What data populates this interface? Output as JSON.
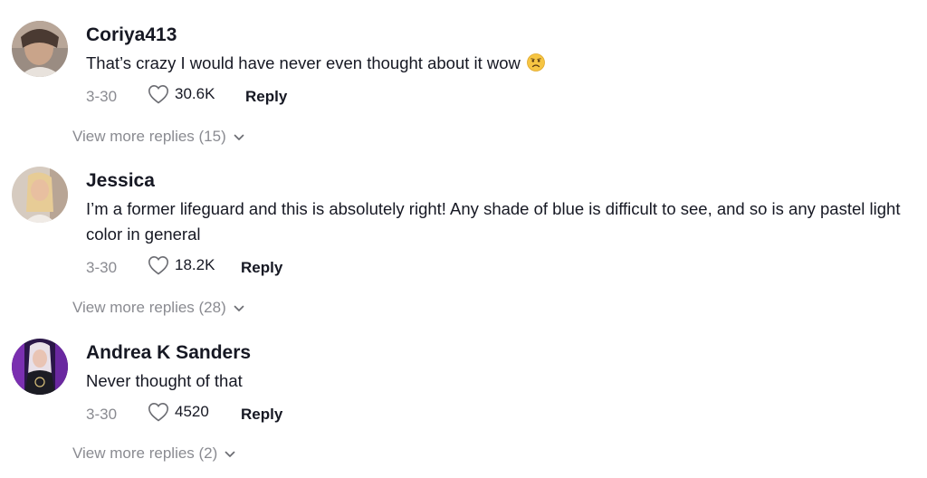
{
  "comments": [
    {
      "username": "Coriya413",
      "text": "That’s crazy I would have never even thought about it wow",
      "emoji": "worried-face-emoji",
      "date": "3-30",
      "likes": "30.6K",
      "reply_label": "Reply",
      "view_more": "View more replies (15)",
      "avatar_colors": [
        "#8a7a70",
        "#d9c8b8"
      ]
    },
    {
      "username": "Jessica",
      "text": "I’m a former lifeguard and this is absolutely right! Any shade of blue is difficult to see, and so is any pastel light color in general",
      "date": "3-30",
      "likes": "18.2K",
      "reply_label": "Reply",
      "view_more": "View more replies (28)",
      "avatar_colors": [
        "#d8cfc6",
        "#e8d2a8"
      ]
    },
    {
      "username": "Andrea K Sanders",
      "text": "Never thought of that",
      "date": "3-30",
      "likes": "4520",
      "reply_label": "Reply",
      "view_more": "View more replies (2)",
      "avatar_colors": [
        "#5a2a8a",
        "#c040d0"
      ]
    }
  ],
  "icons": {
    "like": "heart-outline-icon",
    "expand": "chevron-down-icon"
  }
}
